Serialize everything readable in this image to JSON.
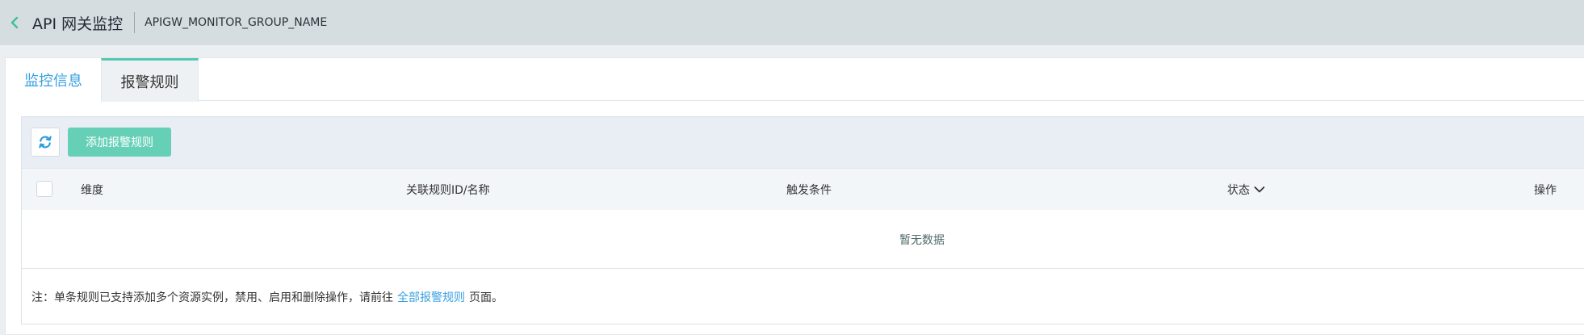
{
  "header": {
    "back_icon": "chevron-left-icon",
    "title": "API 网关监控",
    "group_name": "APIGW_MONITOR_GROUP_NAME"
  },
  "tabs": [
    {
      "label": "监控信息",
      "active": false
    },
    {
      "label": "报警规则",
      "active": true
    }
  ],
  "toolbar": {
    "refresh_icon": "refresh-icon",
    "add_label": "添加报警规则"
  },
  "table": {
    "columns": [
      "维度",
      "关联规则ID/名称",
      "触发条件",
      "状态",
      "操作"
    ],
    "empty_text": "暂无数据"
  },
  "note": {
    "prefix": "注：单条规则已支持添加多个资源实例，禁用、启用和删除操作，请前往",
    "link": "全部报警规则",
    "suffix": "页面。"
  },
  "colors": {
    "accent_teal": "#54c8b0",
    "add_button": "#66d0b7",
    "link_blue": "#3aa0e0",
    "header_bg": "#d5dde0"
  }
}
